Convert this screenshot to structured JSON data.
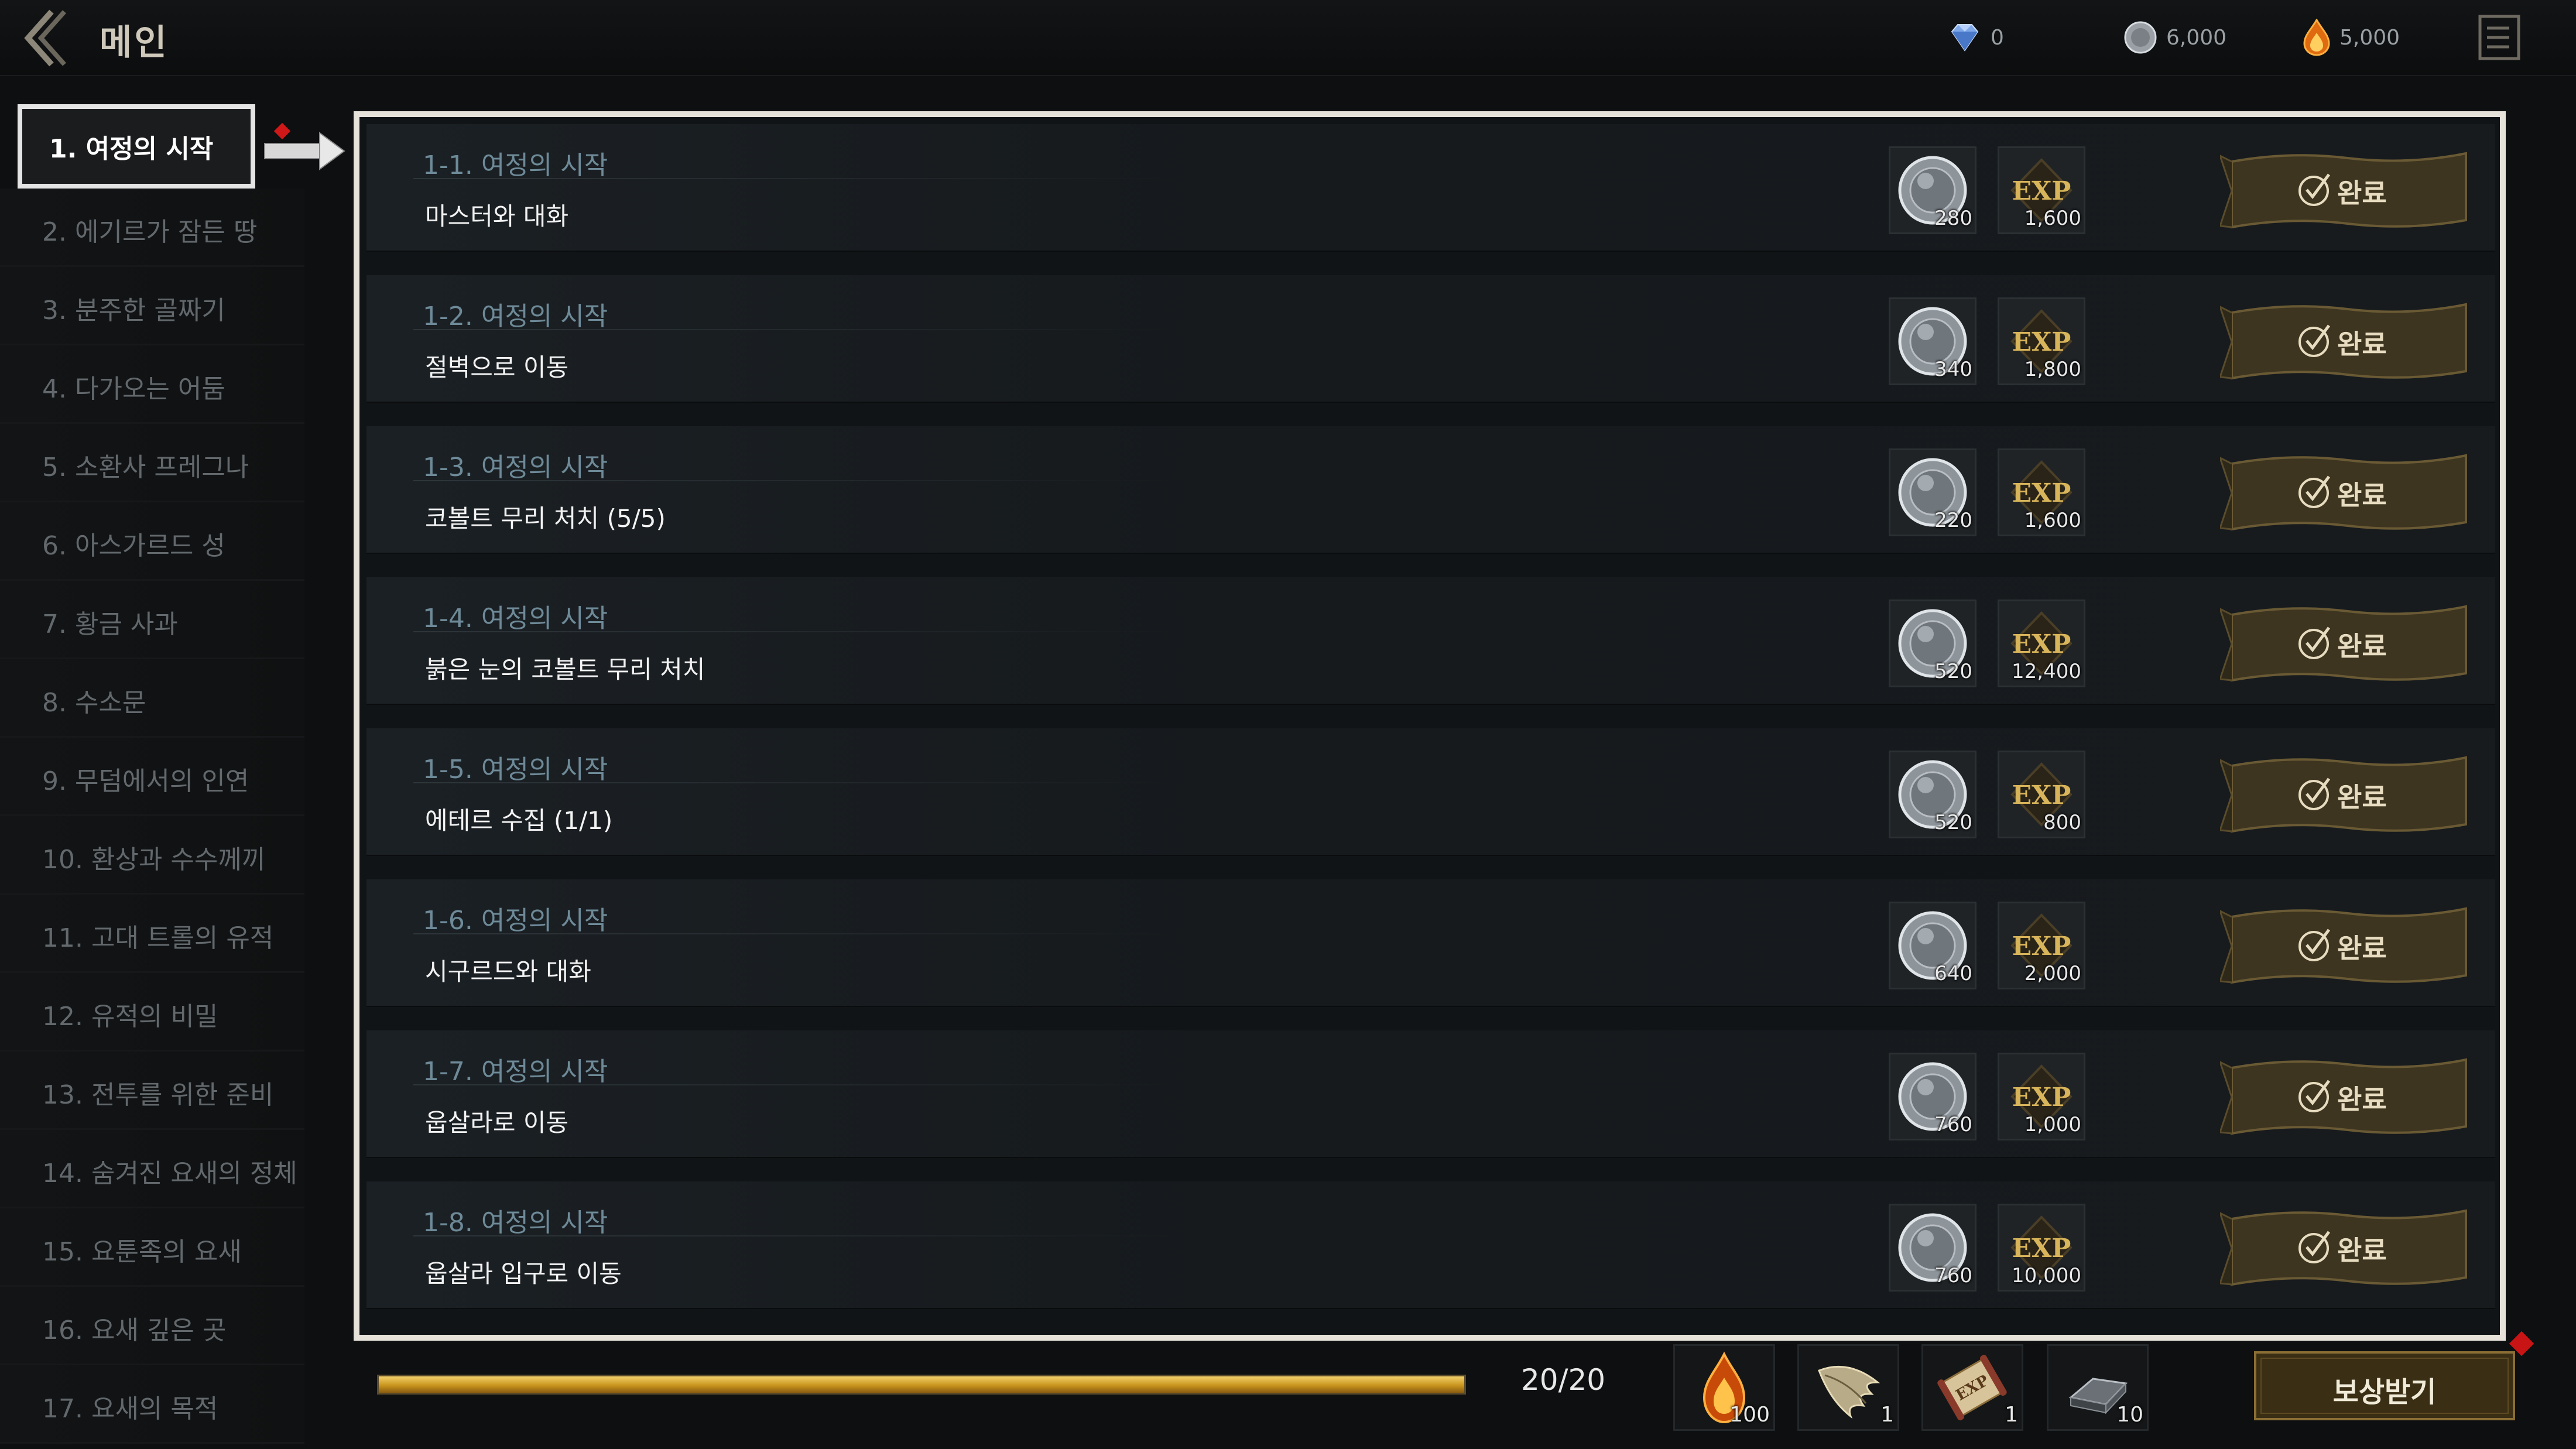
{
  "header": {
    "title": "메인",
    "currencies": [
      {
        "icon": "diamond-icon",
        "value": "0"
      },
      {
        "icon": "silver-coin-icon",
        "value": "6,000"
      },
      {
        "icon": "fire-gem-icon",
        "value": "5,000"
      }
    ]
  },
  "sidebar": {
    "items": [
      {
        "label": "1. 여정의 시작"
      },
      {
        "label": "2. 에기르가 잠든 땅"
      },
      {
        "label": "3. 분주한 골짜기"
      },
      {
        "label": "4. 다가오는 어둠"
      },
      {
        "label": "5. 소환사 프레그나"
      },
      {
        "label": "6. 아스가르드 성"
      },
      {
        "label": "7. 황금 사과"
      },
      {
        "label": "8. 수소문"
      },
      {
        "label": "9. 무덤에서의 인연"
      },
      {
        "label": "10. 환상과 수수께끼"
      },
      {
        "label": "11. 고대 트롤의 유적"
      },
      {
        "label": "12. 유적의 비밀"
      },
      {
        "label": "13. 전투를 위한 준비"
      },
      {
        "label": "14. 숨겨진 요새의 정체"
      },
      {
        "label": "15. 요툰족의 요새"
      },
      {
        "label": "16. 요새 깊은 곳"
      },
      {
        "label": "17. 요새의 목적"
      }
    ]
  },
  "quests": [
    {
      "title": "1-1. 여정의 시작",
      "desc": "마스터와 대화",
      "coin": "280",
      "exp": "1,600",
      "button": "완료"
    },
    {
      "title": "1-2. 여정의 시작",
      "desc": "절벽으로 이동",
      "coin": "340",
      "exp": "1,800",
      "button": "완료"
    },
    {
      "title": "1-3. 여정의 시작",
      "desc": "코볼트 무리 처치 (5/5)",
      "coin": "220",
      "exp": "1,600",
      "button": "완료"
    },
    {
      "title": "1-4. 여정의 시작",
      "desc": "붉은 눈의 코볼트 무리 처치",
      "coin": "520",
      "exp": "12,400",
      "button": "완료"
    },
    {
      "title": "1-5. 여정의 시작",
      "desc": "에테르 수집 (1/1)",
      "coin": "520",
      "exp": "800",
      "button": "완료"
    },
    {
      "title": "1-6. 여정의 시작",
      "desc": "시구르드와 대화",
      "coin": "640",
      "exp": "2,000",
      "button": "완료"
    },
    {
      "title": "1-7. 여정의 시작",
      "desc": "웁살라로 이동",
      "coin": "760",
      "exp": "1,000",
      "button": "완료"
    },
    {
      "title": "1-8. 여정의 시작",
      "desc": "웁살라 입구로 이동",
      "coin": "760",
      "exp": "10,000",
      "button": "완료"
    }
  ],
  "progress": {
    "text": "20/20",
    "fraction": 1.0
  },
  "bottom_rewards": [
    {
      "icon": "fire-gem-icon",
      "amount": "100"
    },
    {
      "icon": "wing-icon",
      "amount": "1"
    },
    {
      "icon": "exp-scroll-icon",
      "amount": "1"
    },
    {
      "icon": "iron-ingot-icon",
      "amount": "10"
    }
  ],
  "claim_button": "보상받기",
  "colors": {
    "accent_gold": "#c9951e",
    "active_border": "#e4e4e4",
    "title_blue": "#6e8a98",
    "alert_red": "#d01818"
  }
}
